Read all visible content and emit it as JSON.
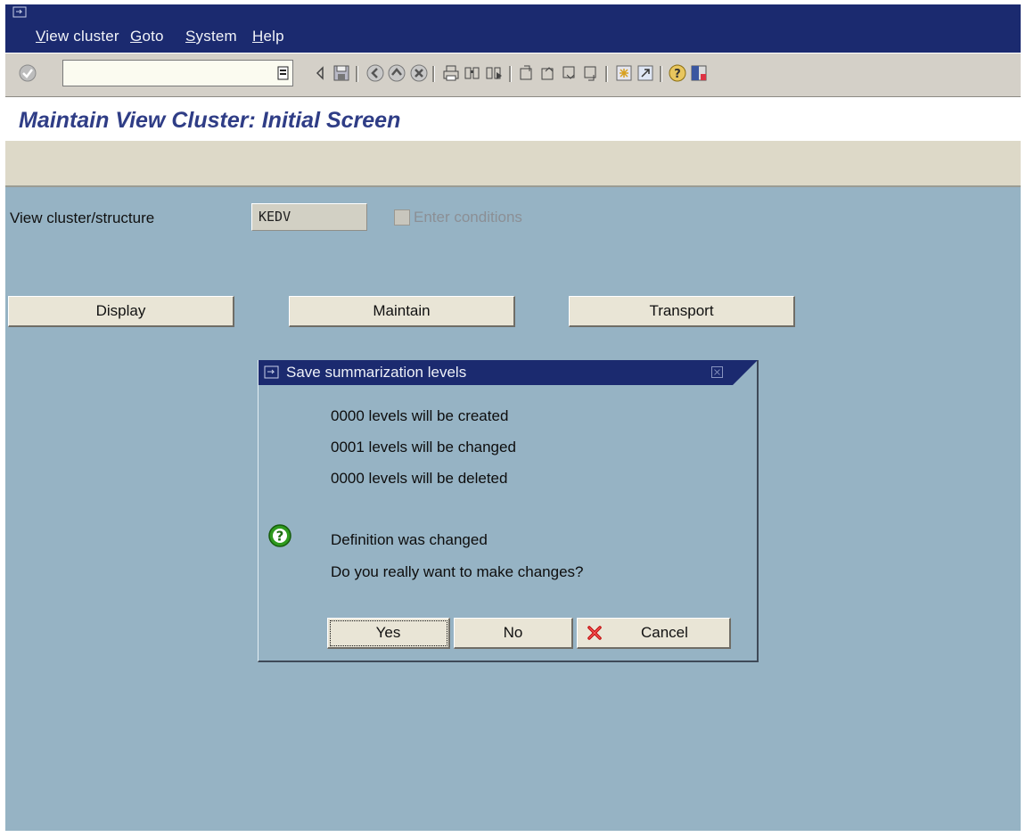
{
  "menubar": {
    "items": [
      {
        "label": "View cluster"
      },
      {
        "label": "Goto"
      },
      {
        "label": "System"
      },
      {
        "label": "Help"
      }
    ]
  },
  "toolbar": {
    "command_field_value": "",
    "icons": [
      "enter-icon",
      "dropdown-icon",
      "back-arrow-icon",
      "save-icon",
      "back-icon",
      "exit-icon",
      "cancel-icon",
      "print-icon",
      "find-icon",
      "find-next-icon",
      "first-page-icon",
      "previous-page-icon",
      "next-page-icon",
      "last-page-icon",
      "create-session-icon",
      "shortcut-icon",
      "help-icon",
      "layout-icon"
    ]
  },
  "page": {
    "title": "Maintain View Cluster: Initial Screen"
  },
  "form": {
    "field_label": "View cluster/structure",
    "field_value": "KEDV",
    "checkbox_label": "Enter conditions",
    "checkbox_checked": false,
    "checkbox_enabled": false
  },
  "actions": {
    "display": "Display",
    "maintain": "Maintain",
    "transport": "Transport"
  },
  "dialog": {
    "title": "Save summarization levels",
    "lines": [
      "0000 levels will be created",
      "0001 levels will be changed",
      "0000 levels will be deleted"
    ],
    "message1": "Definition was changed",
    "message2": "Do you really want to make changes?",
    "yes": "Yes",
    "no": "No",
    "cancel": "Cancel"
  },
  "colors": {
    "menubar": "#1b2a6f",
    "workarea": "#96b3c4",
    "title": "#2f3d86"
  }
}
